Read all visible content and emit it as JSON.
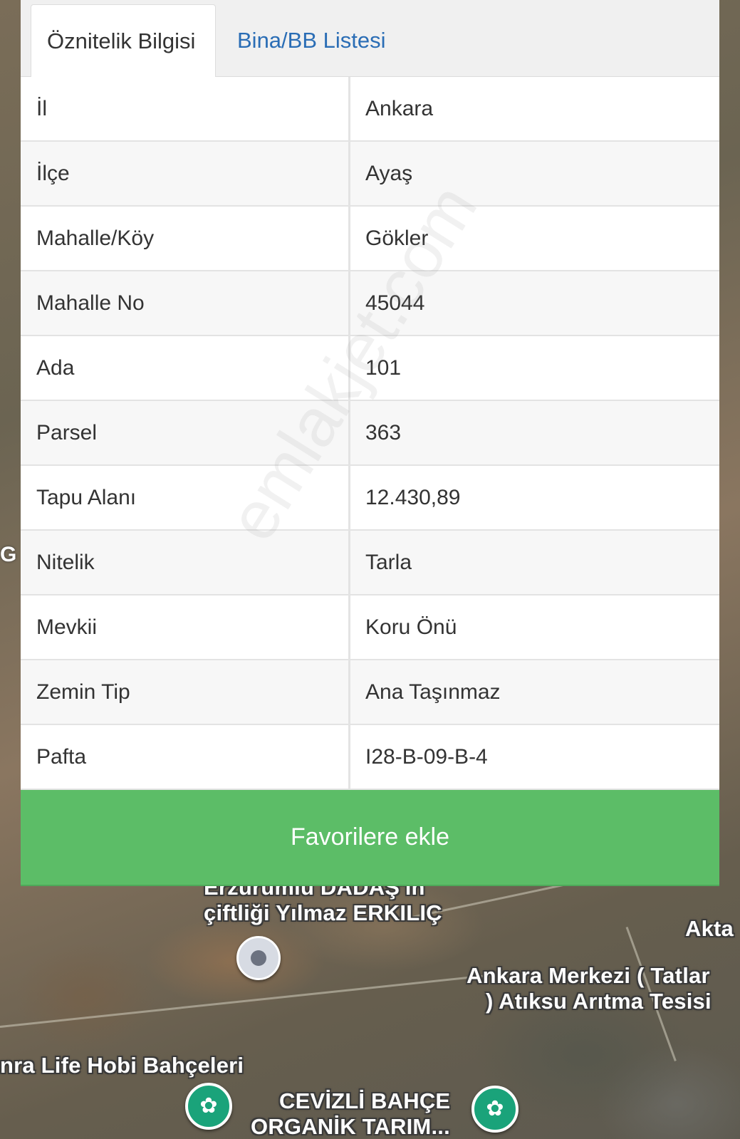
{
  "tabs": [
    {
      "label": "Öznitelik Bilgisi",
      "active": true
    },
    {
      "label": "Bina/BB Listesi",
      "active": false
    }
  ],
  "attributes": [
    {
      "key": "İl",
      "value": "Ankara"
    },
    {
      "key": "İlçe",
      "value": "Ayaş"
    },
    {
      "key": "Mahalle/Köy",
      "value": "Gökler"
    },
    {
      "key": "Mahalle No",
      "value": "45044"
    },
    {
      "key": "Ada",
      "value": "101"
    },
    {
      "key": "Parsel",
      "value": "363"
    },
    {
      "key": "Tapu Alanı",
      "value": "12.430,89"
    },
    {
      "key": "Nitelik",
      "value": "Tarla"
    },
    {
      "key": "Mevkii",
      "value": "Koru Önü"
    },
    {
      "key": "Zemin Tip",
      "value": "Ana Taşınmaz"
    },
    {
      "key": "Pafta",
      "value": "I28-B-09-B-4"
    }
  ],
  "favorite_button": {
    "label": "Favorilere ekle"
  },
  "watermark": "emlakjet.com",
  "map": {
    "labels": {
      "farm_line1": "Erzurumlu DADAŞ'ın",
      "farm_line2": "çiftliği Yılmaz ERKILIÇ",
      "akta": "Akta",
      "plant_line1": "Ankara Merkezi ( Tatlar",
      "plant_line2": ") Atıksu Arıtma Tesisi",
      "hobby": "nra Life Hobi Bahçeleri",
      "cevizli_line1": "CEVİZLİ BAHÇE",
      "cevizli_line2": "ORGANİK TARIM...",
      "edge": "G"
    },
    "colors": {
      "pin_green": "#1aa37a",
      "pin_grey": "#d7dbe3"
    }
  },
  "colors": {
    "accent_green": "#5cbd67",
    "tab_link": "#2a6db5"
  }
}
